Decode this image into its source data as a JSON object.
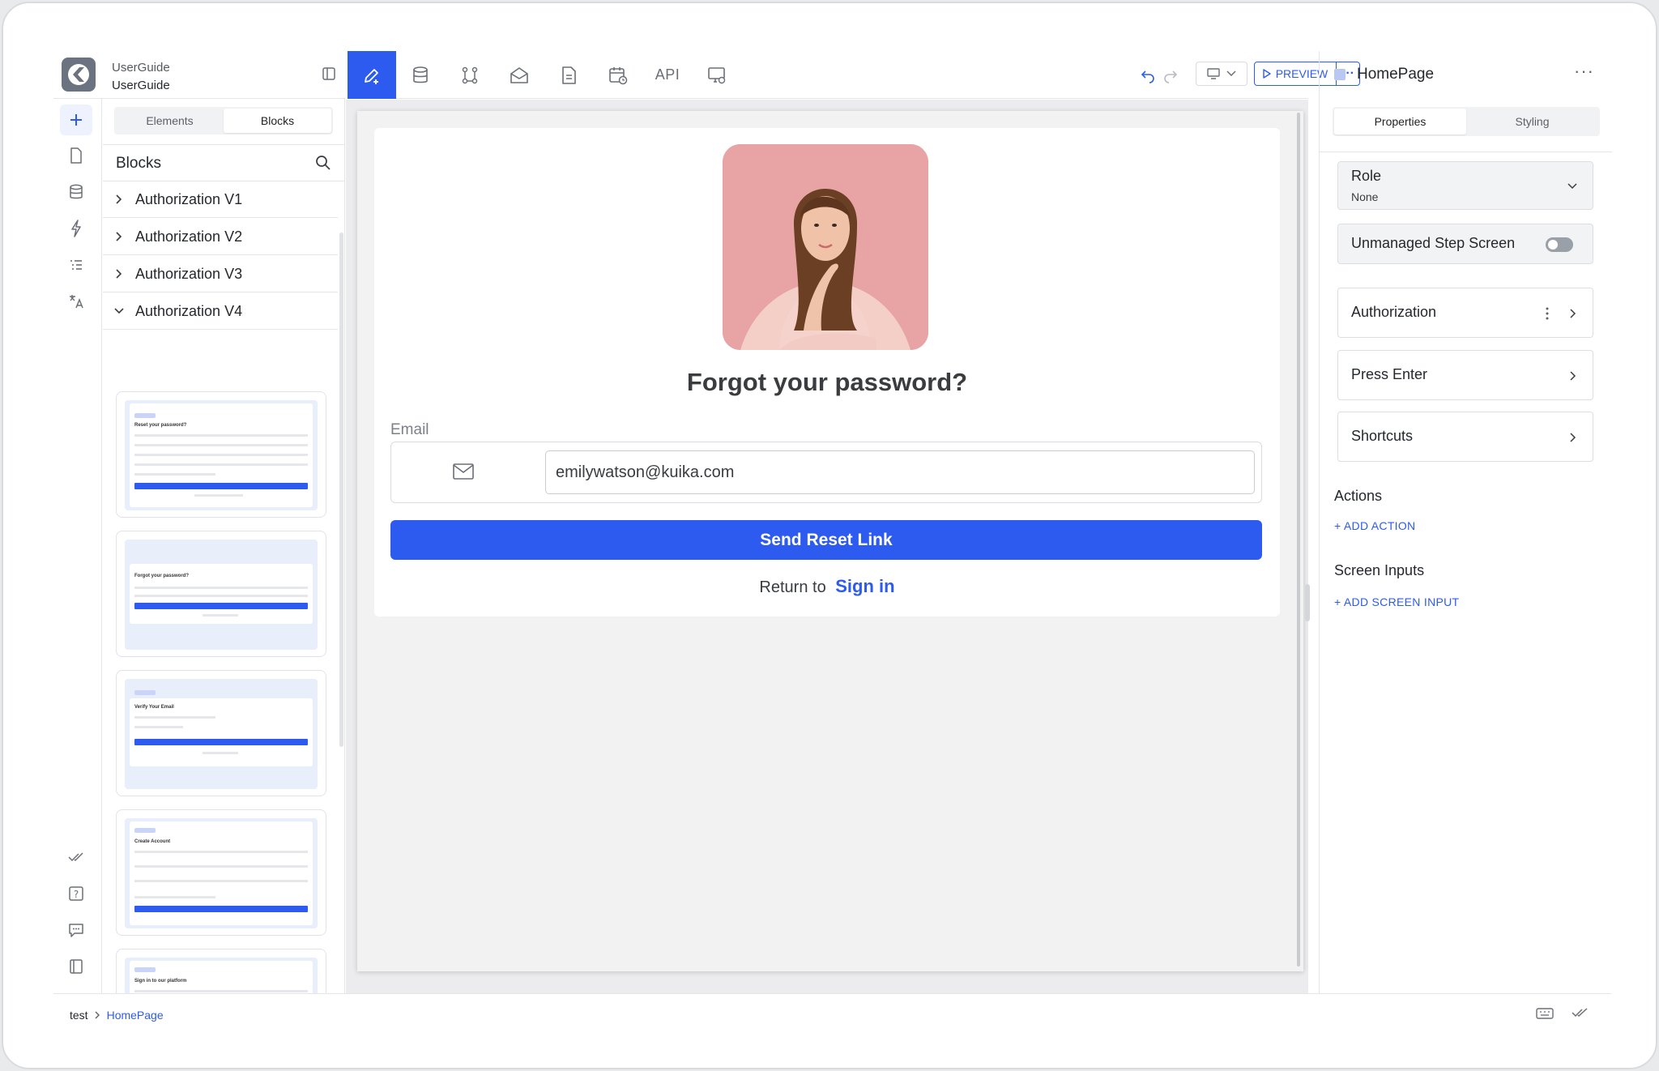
{
  "project": {
    "line1": "UserGuide",
    "line2": "UserGuide"
  },
  "toolbar": {
    "tools": [
      "design-tool",
      "database-tool",
      "workflow-tool",
      "email-tool",
      "document-tool",
      "scheduler-tool",
      "api-tool",
      "monitor-settings-tool"
    ],
    "api_label": "API",
    "preview_label": "PREVIEW"
  },
  "left_panel": {
    "tabs": [
      "Elements",
      "Blocks"
    ],
    "active_tab": "Blocks",
    "blocks_title": "Blocks",
    "groups": [
      {
        "label": "Authorization V1",
        "expanded": false
      },
      {
        "label": "Authorization V2",
        "expanded": false
      },
      {
        "label": "Authorization V3",
        "expanded": false
      },
      {
        "label": "Authorization V4",
        "expanded": true
      }
    ],
    "thumbnails": [
      "Reset your password?",
      "Forgot your password?",
      "Verify Your Email",
      "Create Account",
      "Sign in to our platform"
    ]
  },
  "canvas": {
    "title": "Forgot your password?",
    "email_label": "Email",
    "email_value": "emilywatson@kuika.com",
    "button_label": "Send Reset Link",
    "return_text": "Return to",
    "return_link": "Sign in"
  },
  "right_panel": {
    "title": "HomePage",
    "tabs": [
      "Properties",
      "Styling"
    ],
    "active_tab": "Properties",
    "role_label": "Role",
    "role_value": "None",
    "unmanaged_label": "Unmanaged Step Screen",
    "unmanaged_on": false,
    "authorization_label": "Authorization",
    "press_enter_label": "Press Enter",
    "shortcuts_label": "Shortcuts",
    "actions_title": "Actions",
    "add_action": "+ ADD ACTION",
    "screen_inputs_title": "Screen Inputs",
    "add_screen_input": "+ ADD SCREEN INPUT"
  },
  "statusbar": {
    "crumb_root": "test",
    "crumb_current": "HomePage"
  },
  "colors": {
    "accent": "#2d5bf0",
    "photo_bg": "#e9a6a8"
  }
}
